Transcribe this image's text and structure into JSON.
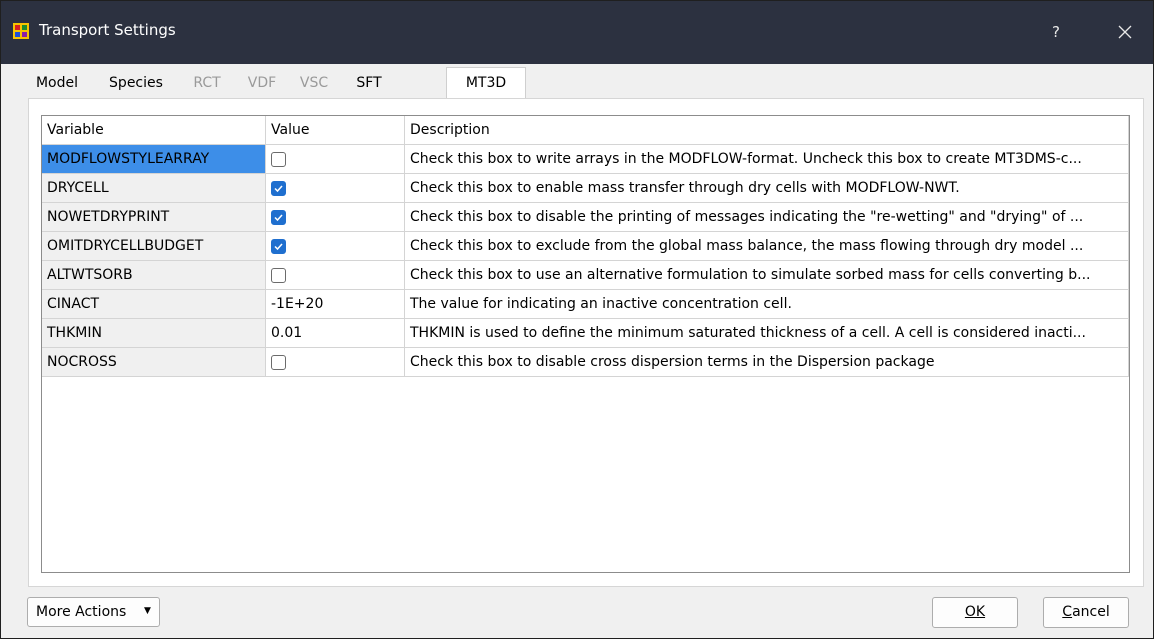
{
  "window": {
    "title": "Transport Settings",
    "help_glyph": "?",
    "icons": {
      "app": "modflow-app-icon",
      "close": "close-icon"
    }
  },
  "tabs": [
    {
      "label": "Model",
      "state": "enabled"
    },
    {
      "label": "Species",
      "state": "enabled"
    },
    {
      "label": "RCT",
      "state": "disabled"
    },
    {
      "label": "VDF",
      "state": "disabled"
    },
    {
      "label": "VSC",
      "state": "disabled"
    },
    {
      "label": "SFT",
      "state": "enabled"
    },
    {
      "label": "MT3D",
      "state": "active"
    }
  ],
  "table": {
    "columns": [
      "Variable",
      "Value",
      "Description"
    ],
    "rows": [
      {
        "variable": "MODFLOWSTYLEARRAY",
        "value_type": "checkbox",
        "checked": false,
        "value": "",
        "description": "Check this box to write arrays in the MODFLOW-format. Uncheck this box to create MT3DMS-c...",
        "selected": true
      },
      {
        "variable": "DRYCELL",
        "value_type": "checkbox",
        "checked": true,
        "value": "",
        "description": "Check this box to enable mass transfer through dry cells with MODFLOW-NWT.",
        "selected": false
      },
      {
        "variable": "NOWETDRYPRINT",
        "value_type": "checkbox",
        "checked": true,
        "value": "",
        "description": "Check this box to disable the printing of messages indicating the \"re-wetting\" and \"drying\" of ...",
        "selected": false
      },
      {
        "variable": "OMITDRYCELLBUDGET",
        "value_type": "checkbox",
        "checked": true,
        "value": "",
        "description": "Check this box to exclude from the global mass balance, the mass flowing through dry model ...",
        "selected": false
      },
      {
        "variable": "ALTWTSORB",
        "value_type": "checkbox",
        "checked": false,
        "value": "",
        "description": "Check this box to use an alternative formulation to simulate sorbed mass for cells converting b...",
        "selected": false
      },
      {
        "variable": "CINACT",
        "value_type": "text",
        "checked": false,
        "value": "-1E+20",
        "description": "The value for indicating an inactive concentration cell.",
        "selected": false
      },
      {
        "variable": "THKMIN",
        "value_type": "text",
        "checked": false,
        "value": "0.01",
        "description": "THKMIN is used to define the minimum saturated thickness of a cell. A cell is considered inacti...",
        "selected": false
      },
      {
        "variable": "NOCROSS",
        "value_type": "checkbox",
        "checked": false,
        "value": "",
        "description": "Check this box to disable cross dispersion terms in the Dispersion package",
        "selected": false
      }
    ]
  },
  "footer": {
    "more_actions_label": "More Actions",
    "ok_label": "OK",
    "cancel_first": "C",
    "cancel_rest": "ancel"
  },
  "colors": {
    "titlebar": "#2c3140",
    "selection": "#3d8ee8",
    "checkbox_checked": "#1f6fcf"
  }
}
